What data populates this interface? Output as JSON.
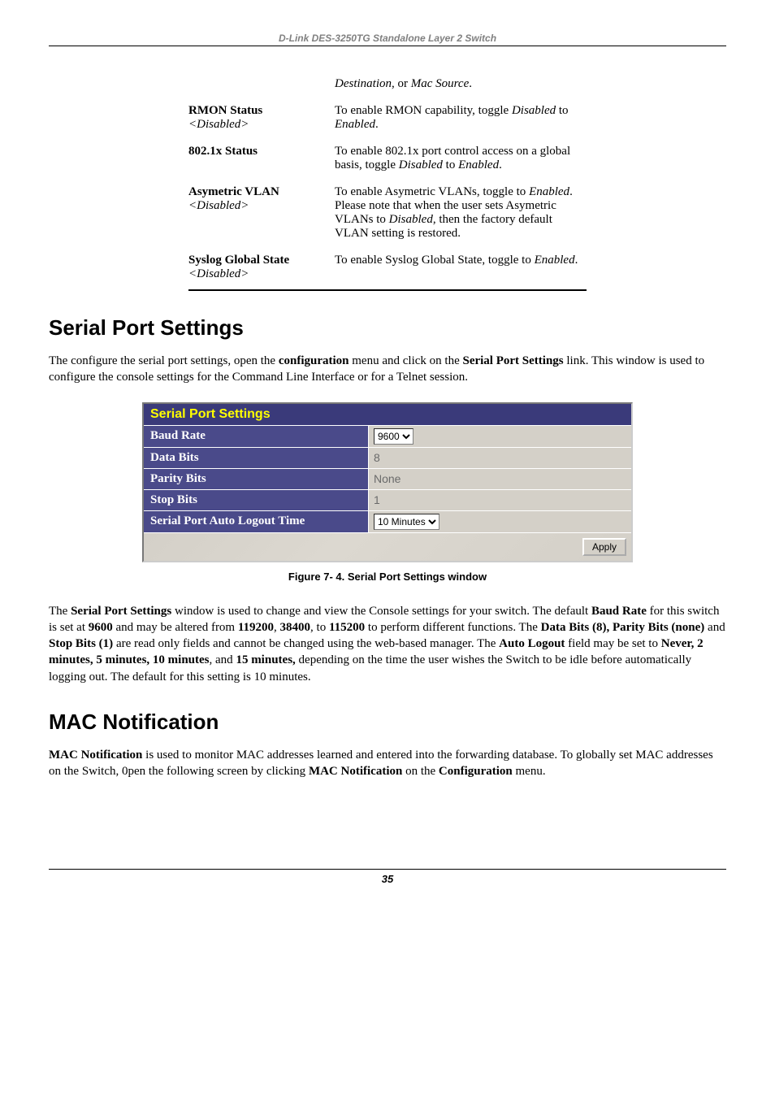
{
  "header": "D-Link DES-3250TG Standalone Layer 2 Switch",
  "top_fragment": {
    "dest_line": "Destination",
    "dest_or": ", or ",
    "mac_source": "Mac Source",
    "dest_period": "."
  },
  "params": {
    "rmon": {
      "label": "RMON Status",
      "state": "<Disabled>",
      "desc_pre": "To enable RMON capability, toggle ",
      "desc_i1": "Disabled",
      "desc_mid": " to ",
      "desc_i2": "Enabled",
      "desc_post": "."
    },
    "dot1x": {
      "label": "802.1x Status",
      "desc_pre": "To enable 802.1x port control access on a global basis, toggle ",
      "desc_i1": "Disabled",
      "desc_mid": " to ",
      "desc_i2": "Enabled",
      "desc_post": "."
    },
    "avlan": {
      "label": "Asymetric VLAN",
      "state": "<Disabled>",
      "desc_pre": "To enable Asymetric VLANs, toggle to ",
      "desc_i1": "Enabled",
      "desc_mid1": ". Please note that when the user sets Asymetric VLANs to ",
      "desc_i2": "Disabled",
      "desc_post": ", then the factory default VLAN setting is restored."
    },
    "syslog": {
      "label": "Syslog Global State",
      "state": "<Disabled>",
      "desc_pre": "To enable Syslog Global State, toggle to ",
      "desc_i1": "Enabled",
      "desc_post": "."
    }
  },
  "section1": {
    "title": "Serial Port Settings",
    "para_pre": "The configure the serial port settings, open the ",
    "para_b1": "configuration",
    "para_mid": " menu and click on the ",
    "para_b2": "Serial Port Settings",
    "para_post": " link. This window is used to configure the console settings for the Command Line Interface or for a Telnet session."
  },
  "ui": {
    "title": "Serial Port Settings",
    "baud_label": "Baud Rate",
    "baud_value": "9600",
    "databits_label": "Data Bits",
    "databits_value": "8",
    "parity_label": "Parity Bits",
    "parity_value": "None",
    "stop_label": "Stop Bits",
    "stop_value": "1",
    "logout_label": "Serial Port Auto Logout Time",
    "logout_value": "10 Minutes",
    "apply": "Apply"
  },
  "figure_caption": "Figure 7- 4. Serial Port Settings window",
  "para2": {
    "t1": "The ",
    "b1": "Serial Port Settings",
    "t2": " window is used to change and view the Console settings for your switch. The default ",
    "b2": "Baud Rate",
    "t3": " for this switch is set at ",
    "b3": "9600",
    "t4": " and may be altered from ",
    "b4": "119200",
    "t5": ", ",
    "b5": "38400",
    "t6": ", to ",
    "b6": "115200",
    "t7": " to perform different functions. The ",
    "b7": "Data Bits (8), Parity Bits (none)",
    "t8": " and ",
    "b8": "Stop Bits (1)",
    "t9": " are read only fields and cannot be changed using the web-based manager. The ",
    "b9": "Auto Logout",
    "t10": " field may be set to ",
    "b10": "Never, 2 minutes, 5 minutes, 10 minutes",
    "t11": ", and ",
    "b11": "15 minutes,",
    "t12": " depending on the time the user wishes the Switch to be idle before automatically logging out. The default for this setting is 10 minutes."
  },
  "section2": {
    "title": "MAC Notification",
    "t1_b": "MAC Notification",
    "t1": " is used to monitor MAC addresses learned and entered into the forwarding database.  To globally set MAC addresses on the Switch, 0pen the following screen by clicking ",
    "t2_b": "MAC Notification",
    "t2": " on the ",
    "t3_b": "Configuration",
    "t3": " menu."
  },
  "page_number": "35"
}
